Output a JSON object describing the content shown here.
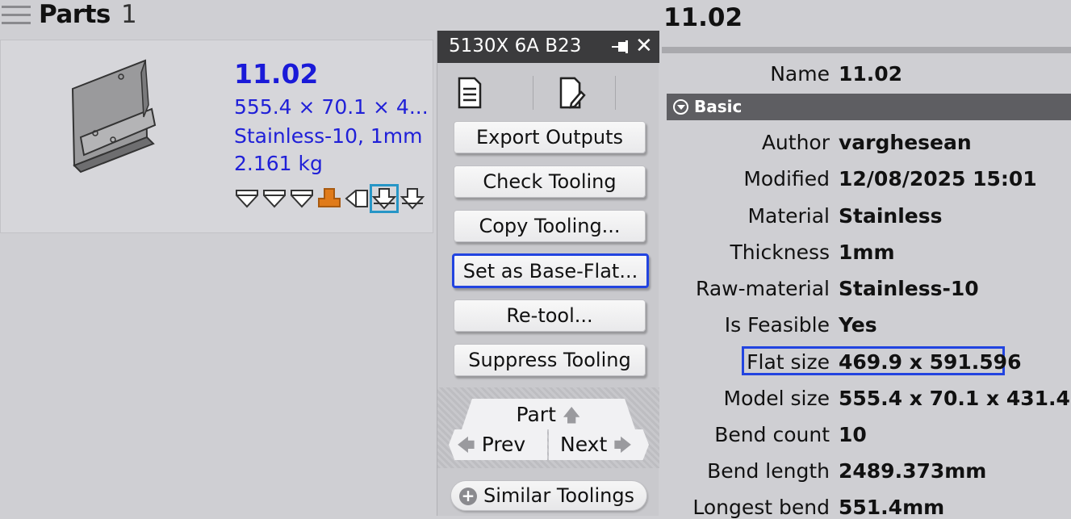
{
  "parts_header": {
    "title": "Parts",
    "count": "1"
  },
  "part_card": {
    "name": "11.02",
    "dimensions": "555.4 × 70.1 × 4...",
    "material": "Stainless-10, 1mm",
    "weight": "2.161 kg",
    "bend_icons": [
      "bend-down-icon",
      "bend-down-icon",
      "bend-down-icon",
      "bend-up-orange-icon",
      "bend-side-icon",
      "bend-down-arrow-icon",
      "bend-down-arrow-icon"
    ],
    "selected_bend_index": 5,
    "colors": {
      "accent_text": "#1a1ad8",
      "bend_orange": "#e07b1a",
      "selection": "#2796c6"
    }
  },
  "panel": {
    "title": "5130X 6A B23",
    "buttons": [
      {
        "label": "Export Outputs"
      },
      {
        "label": "Check Tooling"
      },
      {
        "label": "Copy Tooling..."
      },
      {
        "label": "Set as Base-Flat..."
      },
      {
        "label": "Re-tool..."
      },
      {
        "label": "Suppress Tooling"
      }
    ],
    "highlighted_button_index": 3,
    "nav": {
      "part": "Part",
      "prev": "Prev",
      "next": "Next"
    },
    "similar": "Similar Toolings"
  },
  "properties": {
    "title": "11.02",
    "name_label": "Name",
    "name_value": "11.02",
    "section": "Basic",
    "rows": [
      {
        "label": "Author",
        "value": "varghesean"
      },
      {
        "label": "Modified",
        "value": "12/08/2025 15:01"
      },
      {
        "label": "Material",
        "value": "Stainless"
      },
      {
        "label": "Thickness",
        "value": "1mm"
      },
      {
        "label": "Raw-material",
        "value": "Stainless-10"
      },
      {
        "label": "Is Feasible",
        "value": "Yes"
      },
      {
        "label": "Flat size",
        "value": "469.9 x 591.596"
      },
      {
        "label": "Model size",
        "value": "555.4 x 70.1 x 431.4"
      },
      {
        "label": "Bend count",
        "value": "10"
      },
      {
        "label": "Bend length",
        "value": "2489.373mm"
      },
      {
        "label": "Longest bend",
        "value": "551.4mm"
      }
    ],
    "highlight_color": "#2244e0"
  }
}
